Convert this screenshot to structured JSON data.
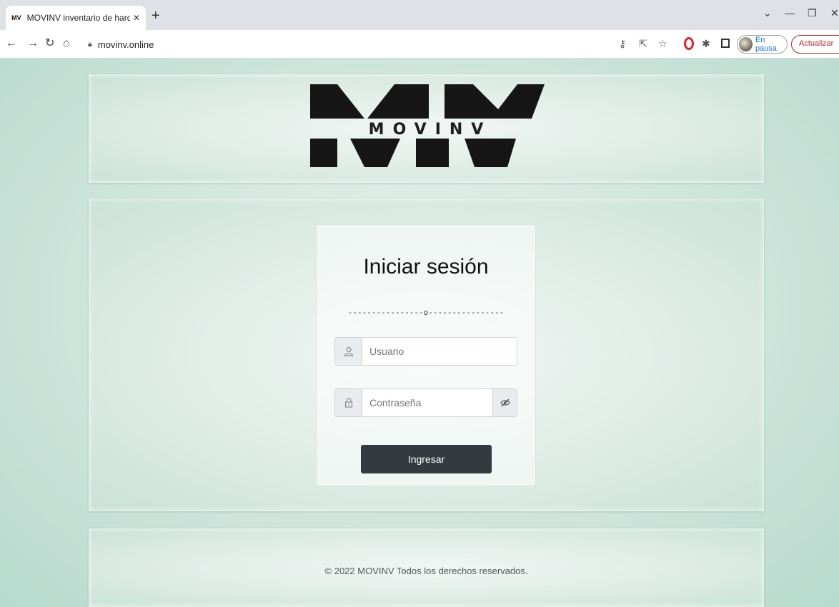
{
  "browser": {
    "tab_title": "MOVINV inventario de hardware",
    "tab_favicon": "MV",
    "new_tab_label": "+",
    "url": "movinv.online",
    "profile_label": "En pausa",
    "update_label": "Actualizar",
    "icons": [
      "back-icon",
      "forward-icon",
      "reload-icon",
      "home-icon",
      "lock-icon",
      "key-icon",
      "share-icon",
      "star-icon",
      "opera-icon",
      "extensions-icon",
      "sidebar-icon"
    ]
  },
  "header": {
    "logo_text": "MOVINV"
  },
  "login": {
    "title": "Iniciar sesión",
    "divider": "----------------o----------------",
    "username_placeholder": "Usuario",
    "password_placeholder": "Contraseña",
    "submit_label": "Ingresar"
  },
  "footer": {
    "copyright": "© 2022 MOVINV Todos los derechos reservados."
  },
  "colors": {
    "background": "#c9e2d8",
    "button": "#343a40",
    "update_accent": "#c5221f",
    "profile_accent": "#1a73e8"
  }
}
